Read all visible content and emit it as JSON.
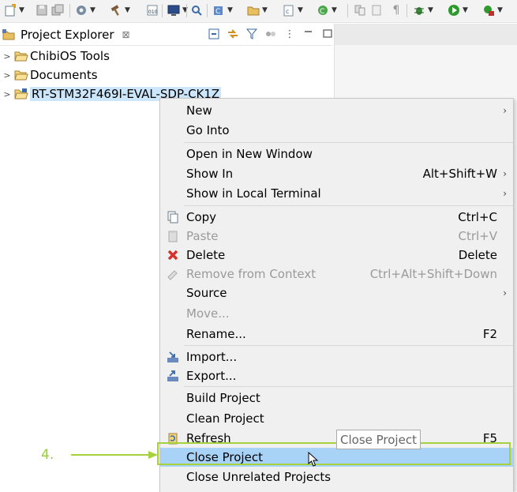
{
  "explorer": {
    "title": "Project Explorer",
    "close_glyph": "⊠",
    "tree": [
      {
        "label": "ChibiOS Tools"
      },
      {
        "label": "Documents"
      },
      {
        "label": "RT-STM32F469I-EVAL-SDP-CK1Z"
      }
    ]
  },
  "menu": {
    "items": {
      "new": {
        "label": "New"
      },
      "go_into": {
        "label": "Go Into"
      },
      "open_new_window": {
        "label": "Open in New Window"
      },
      "show_in": {
        "label": "Show In",
        "shortcut": "Alt+Shift+W"
      },
      "show_local_terminal": {
        "label": "Show in Local Terminal"
      },
      "copy": {
        "label": "Copy",
        "shortcut": "Ctrl+C"
      },
      "paste": {
        "label": "Paste",
        "shortcut": "Ctrl+V"
      },
      "delete": {
        "label": "Delete",
        "shortcut": "Delete"
      },
      "remove_context": {
        "label": "Remove from Context",
        "shortcut": "Ctrl+Alt+Shift+Down"
      },
      "source": {
        "label": "Source"
      },
      "move": {
        "label": "Move..."
      },
      "rename": {
        "label": "Rename...",
        "shortcut": "F2"
      },
      "import": {
        "label": "Import..."
      },
      "export": {
        "label": "Export..."
      },
      "build_project": {
        "label": "Build Project"
      },
      "clean_project": {
        "label": "Clean Project"
      },
      "refresh": {
        "label": "Refresh",
        "shortcut": "F5"
      },
      "close_project": {
        "label": "Close Project"
      },
      "close_unrelated": {
        "label": "Close Unrelated Projects"
      }
    },
    "submenu_glyph": "›"
  },
  "tooltip": {
    "text": "Close Project"
  },
  "annotation": {
    "step": "4."
  },
  "colors": {
    "highlight_row": "#a8d3f7",
    "annotation_green": "#a5d13c",
    "tree_selection": "#cce6fb"
  }
}
